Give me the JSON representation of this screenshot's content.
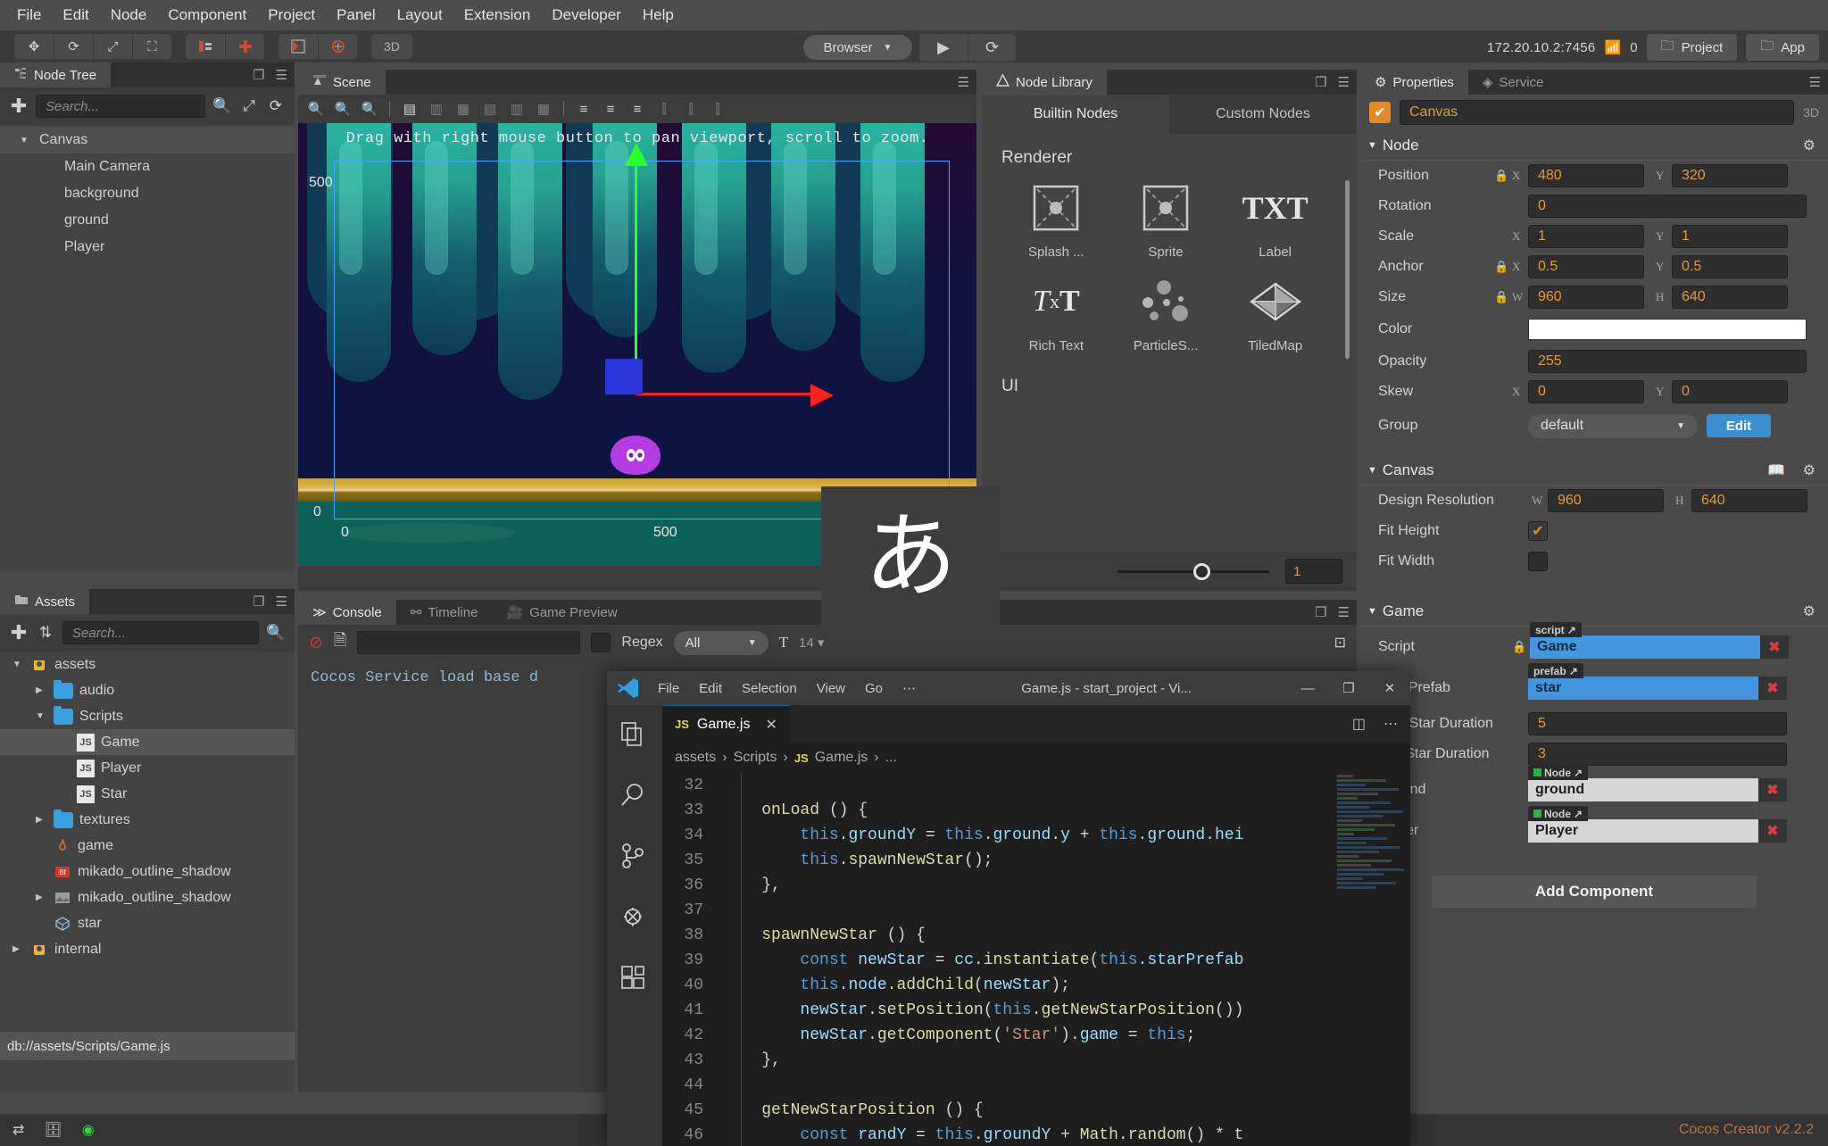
{
  "menubar": {
    "items": [
      "File",
      "Edit",
      "Node",
      "Component",
      "Project",
      "Panel",
      "Layout",
      "Extension",
      "Developer",
      "Help"
    ]
  },
  "toolbar": {
    "transform_tools": [
      "move-icon",
      "rotate-icon",
      "scale-icon",
      "rect-icon"
    ],
    "group_tools": [
      "align-icon",
      "add-node-icon"
    ],
    "render_tools": [
      "canvas-icon",
      "gizmo-icon"
    ],
    "mode_3d": "3D",
    "browser_select": "Browser",
    "play_label": "play-icon",
    "refresh_label": "refresh-icon",
    "ip_address": "172.20.10.2:7456",
    "device_count": "0",
    "project_button": "Project",
    "app_button": "App"
  },
  "node_tree": {
    "tab": "Node Tree",
    "search_placeholder": "Search...",
    "items": [
      {
        "label": "Canvas",
        "depth": 0,
        "expanded": true,
        "selected": true
      },
      {
        "label": "Main Camera",
        "depth": 1,
        "expanded": false,
        "selected": false
      },
      {
        "label": "background",
        "depth": 1,
        "expanded": false,
        "selected": false
      },
      {
        "label": "ground",
        "depth": 1,
        "expanded": false,
        "selected": false
      },
      {
        "label": "Player",
        "depth": 1,
        "expanded": false,
        "selected": false
      }
    ]
  },
  "assets": {
    "tab": "Assets",
    "search_placeholder": "Search...",
    "items": [
      {
        "label": "assets",
        "depth": 0,
        "icon": "assets-root-icon",
        "caret": "down",
        "selected": false
      },
      {
        "label": "audio",
        "depth": 1,
        "icon": "folder-icon",
        "caret": "right",
        "selected": false
      },
      {
        "label": "Scripts",
        "depth": 1,
        "icon": "folder-icon",
        "caret": "down",
        "selected": false
      },
      {
        "label": "Game",
        "depth": 2,
        "icon": "js-icon",
        "caret": "",
        "selected": true
      },
      {
        "label": "Player",
        "depth": 2,
        "icon": "js-icon",
        "caret": "",
        "selected": false
      },
      {
        "label": "Star",
        "depth": 2,
        "icon": "js-icon",
        "caret": "",
        "selected": false
      },
      {
        "label": "textures",
        "depth": 1,
        "icon": "folder-icon",
        "caret": "right",
        "selected": false
      },
      {
        "label": "game",
        "depth": 1,
        "icon": "fire-icon",
        "caret": "",
        "selected": false
      },
      {
        "label": "mikado_outline_shadow",
        "depth": 1,
        "icon": "bitmapfont-icon",
        "caret": "",
        "selected": false
      },
      {
        "label": "mikado_outline_shadow",
        "depth": 1,
        "icon": "texture-icon",
        "caret": "right",
        "selected": false
      },
      {
        "label": "star",
        "depth": 1,
        "icon": "prefab-icon",
        "caret": "",
        "selected": false
      },
      {
        "label": "internal",
        "depth": 0,
        "icon": "assets-root-icon",
        "caret": "right",
        "selected": false
      }
    ],
    "status_path": "db://assets/Scripts/Game.js"
  },
  "scene": {
    "tab": "Scene",
    "hint": "Drag with right mouse button to pan viewport, scroll to zoom.",
    "ruler": {
      "y_top": "500",
      "y_bottom": "0",
      "x_left": "0",
      "x_right": "500"
    },
    "toolbar_icons": [
      "zoom-in-icon",
      "zoom-out-icon",
      "zoom-reset-icon",
      "align-left-icon",
      "align-hcenter-icon",
      "align-right-icon",
      "align-top-icon",
      "align-vcenter-icon",
      "align-bottom-icon",
      "dist-top-icon",
      "dist-middle-icon",
      "dist-bottom-icon",
      "dist-left-icon",
      "dist-center-icon",
      "dist-right-icon"
    ]
  },
  "node_library": {
    "tab": "Node Library",
    "tabs": [
      {
        "label": "Builtin Nodes",
        "active": true
      },
      {
        "label": "Custom Nodes",
        "active": false
      }
    ],
    "categories": [
      {
        "name": "Renderer",
        "items": [
          {
            "label": "Splash ...",
            "icon": "splash-icon"
          },
          {
            "label": "Sprite",
            "icon": "sprite-icon"
          },
          {
            "label": "Label",
            "icon": "label-txt-icon"
          },
          {
            "label": "Rich Text",
            "icon": "richtext-icon"
          },
          {
            "label": "ParticleS...",
            "icon": "particle-icon"
          },
          {
            "label": "TiledMap",
            "icon": "tiledmap-icon"
          }
        ]
      },
      {
        "name": "UI",
        "items": []
      }
    ],
    "zoom_value": "1"
  },
  "console": {
    "tabs": [
      {
        "label": "Console",
        "icon": "console-icon",
        "active": true
      },
      {
        "label": "Timeline",
        "icon": "timeline-icon",
        "active": false
      },
      {
        "label": "Game Preview",
        "icon": "camera-icon",
        "active": false
      }
    ],
    "clear_icon": "clear-icon",
    "file_icon": "file-icon",
    "filter_value": "",
    "regex_label": "Regex",
    "level_select": "All",
    "font_icon": "font-size-icon",
    "log_lines": [
      "Cocos Service load base d"
    ]
  },
  "properties": {
    "tabs": [
      {
        "label": "Properties",
        "icon": "gear-icon",
        "active": true
      },
      {
        "label": "Service",
        "icon": "service-icon",
        "active": false
      }
    ],
    "node_name": "Canvas",
    "enabled": true,
    "is_3d_label": "3D",
    "node_section": {
      "title": "Node",
      "rows": [
        {
          "label": "Position",
          "lock": true,
          "ax1": "X",
          "v1": "480",
          "ax2": "Y",
          "v2": "320"
        },
        {
          "label": "Rotation",
          "lock": false,
          "single": "0"
        },
        {
          "label": "Scale",
          "lock": false,
          "ax1": "X",
          "v1": "1",
          "ax2": "Y",
          "v2": "1"
        },
        {
          "label": "Anchor",
          "lock": true,
          "ax1": "X",
          "v1": "0.5",
          "ax2": "Y",
          "v2": "0.5"
        },
        {
          "label": "Size",
          "lock": true,
          "ax1": "W",
          "v1": "960",
          "ax2": "H",
          "v2": "640"
        }
      ],
      "color_label": "Color",
      "color_value": "#ffffff",
      "opacity_label": "Opacity",
      "opacity_value": "255",
      "skew_label": "Skew",
      "skew_x": "0",
      "skew_y": "0",
      "group_label": "Group",
      "group_value": "default",
      "group_edit": "Edit"
    },
    "canvas_section": {
      "title": "Canvas",
      "design_res_label": "Design Resolution",
      "design_w": "960",
      "design_h": "640",
      "fit_height_label": "Fit Height",
      "fit_height": true,
      "fit_width_label": "Fit Width",
      "fit_width": false
    },
    "game_section": {
      "title": "Game",
      "rows": [
        {
          "label": "Script",
          "tag": "script",
          "value": "Game",
          "style": "blue",
          "lock": true
        },
        {
          "label": "Star Prefab",
          "tag": "prefab",
          "value": "star",
          "style": "blue",
          "lock": false
        },
        {
          "label": "Max Star Duration",
          "value": "5",
          "style": "num"
        },
        {
          "label": "Min Star Duration",
          "value": "3",
          "style": "num"
        },
        {
          "label": "Ground",
          "tag": "Node",
          "value": "ground",
          "style": "gray",
          "lock": false
        },
        {
          "label": "Player",
          "tag": "Node",
          "value": "Player",
          "style": "gray",
          "lock": false
        }
      ],
      "add_component": "Add Component"
    }
  },
  "ime_overlay": {
    "character": "あ"
  },
  "vscode": {
    "menu": [
      "File",
      "Edit",
      "Selection",
      "View",
      "Go",
      "⋯"
    ],
    "title": "Game.js - start_project - Vi...",
    "window_buttons": [
      "minimize-icon",
      "maximize-icon",
      "close-icon"
    ],
    "activity_icons": [
      "explorer-icon",
      "search-icon",
      "source-control-icon",
      "debug-icon",
      "extensions-icon"
    ],
    "tab": {
      "label": "Game.js",
      "badge": "JS",
      "close": "close-icon"
    },
    "tab_actions": [
      "split-editor-icon",
      "more-actions-icon"
    ],
    "breadcrumb": [
      "assets",
      "Scripts",
      "Game.js",
      "..."
    ],
    "code_lines": [
      {
        "n": "32",
        "tokens": []
      },
      {
        "n": "33",
        "tokens": [
          {
            "t": "    ",
            "c": "cd"
          },
          {
            "t": "onLoad",
            "c": "fn"
          },
          {
            "t": " () {",
            "c": "cd"
          }
        ]
      },
      {
        "n": "34",
        "tokens": [
          {
            "t": "        ",
            "c": "cd"
          },
          {
            "t": "this",
            "c": "kw"
          },
          {
            "t": ".groundY",
            "c": "pp"
          },
          {
            "t": " = ",
            "c": "op"
          },
          {
            "t": "this",
            "c": "kw"
          },
          {
            "t": ".ground",
            "c": "pp"
          },
          {
            "t": ".y",
            "c": "pp"
          },
          {
            "t": " + ",
            "c": "op"
          },
          {
            "t": "this",
            "c": "kw"
          },
          {
            "t": ".ground",
            "c": "pp"
          },
          {
            "t": ".hei",
            "c": "pp"
          }
        ]
      },
      {
        "n": "35",
        "tokens": [
          {
            "t": "        ",
            "c": "cd"
          },
          {
            "t": "this",
            "c": "kw"
          },
          {
            "t": ".",
            "c": "op"
          },
          {
            "t": "spawnNewStar",
            "c": "fn"
          },
          {
            "t": "();",
            "c": "cd"
          }
        ]
      },
      {
        "n": "36",
        "tokens": [
          {
            "t": "    },",
            "c": "cd"
          }
        ]
      },
      {
        "n": "37",
        "tokens": []
      },
      {
        "n": "38",
        "tokens": [
          {
            "t": "    ",
            "c": "cd"
          },
          {
            "t": "spawnNewStar",
            "c": "fn"
          },
          {
            "t": " () {",
            "c": "cd"
          }
        ]
      },
      {
        "n": "39",
        "tokens": [
          {
            "t": "        ",
            "c": "cd"
          },
          {
            "t": "const",
            "c": "kw"
          },
          {
            "t": " newStar",
            "c": "vr"
          },
          {
            "t": " = ",
            "c": "op"
          },
          {
            "t": "cc",
            "c": "vr"
          },
          {
            "t": ".",
            "c": "op"
          },
          {
            "t": "instantiate",
            "c": "fn"
          },
          {
            "t": "(",
            "c": "cd"
          },
          {
            "t": "this",
            "c": "kw"
          },
          {
            "t": ".starPrefab",
            "c": "pp"
          }
        ]
      },
      {
        "n": "40",
        "tokens": [
          {
            "t": "        ",
            "c": "cd"
          },
          {
            "t": "this",
            "c": "kw"
          },
          {
            "t": ".node",
            "c": "pp"
          },
          {
            "t": ".",
            "c": "op"
          },
          {
            "t": "addChild",
            "c": "fn"
          },
          {
            "t": "(",
            "c": "cd"
          },
          {
            "t": "newStar",
            "c": "vr"
          },
          {
            "t": ");",
            "c": "cd"
          }
        ]
      },
      {
        "n": "41",
        "tokens": [
          {
            "t": "        ",
            "c": "cd"
          },
          {
            "t": "newStar",
            "c": "vr"
          },
          {
            "t": ".",
            "c": "op"
          },
          {
            "t": "setPosition",
            "c": "fn"
          },
          {
            "t": "(",
            "c": "cd"
          },
          {
            "t": "this",
            "c": "kw"
          },
          {
            "t": ".",
            "c": "op"
          },
          {
            "t": "getNewStarPosition",
            "c": "fn"
          },
          {
            "t": "())",
            "c": "cd"
          }
        ]
      },
      {
        "n": "42",
        "tokens": [
          {
            "t": "        ",
            "c": "cd"
          },
          {
            "t": "newStar",
            "c": "vr"
          },
          {
            "t": ".",
            "c": "op"
          },
          {
            "t": "getComponent",
            "c": "fn"
          },
          {
            "t": "(",
            "c": "cd"
          },
          {
            "t": "'Star'",
            "c": "st"
          },
          {
            "t": ").",
            "c": "cd"
          },
          {
            "t": "game",
            "c": "vr"
          },
          {
            "t": " = ",
            "c": "op"
          },
          {
            "t": "this",
            "c": "kw"
          },
          {
            "t": ";",
            "c": "cd"
          }
        ]
      },
      {
        "n": "43",
        "tokens": [
          {
            "t": "    },",
            "c": "cd"
          }
        ]
      },
      {
        "n": "44",
        "tokens": []
      },
      {
        "n": "45",
        "tokens": [
          {
            "t": "    ",
            "c": "cd"
          },
          {
            "t": "getNewStarPosition",
            "c": "fn"
          },
          {
            "t": " () {",
            "c": "cd"
          }
        ]
      },
      {
        "n": "46",
        "tokens": [
          {
            "t": "        ",
            "c": "cd"
          },
          {
            "t": "const",
            "c": "kw"
          },
          {
            "t": " randY",
            "c": "vr"
          },
          {
            "t": " = ",
            "c": "op"
          },
          {
            "t": "this",
            "c": "kw"
          },
          {
            "t": ".groundY",
            "c": "pp"
          },
          {
            "t": " + ",
            "c": "op"
          },
          {
            "t": "Math",
            "c": "fn"
          },
          {
            "t": ".",
            "c": "op"
          },
          {
            "t": "random",
            "c": "fn"
          },
          {
            "t": "() * t",
            "c": "cd"
          }
        ]
      }
    ]
  },
  "footer": {
    "icons": [
      "sync-icon",
      "database-icon",
      "status-dot-icon"
    ],
    "version": "Cocos Creator v2.2.2"
  }
}
